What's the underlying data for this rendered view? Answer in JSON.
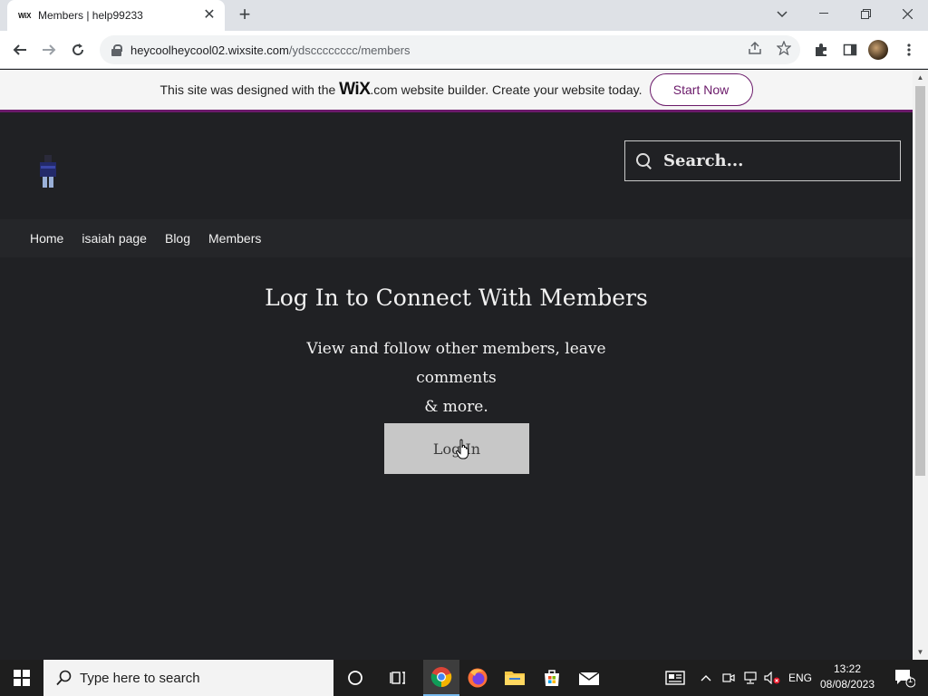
{
  "browser": {
    "tab_favicon": "WiX",
    "tab_title": "Members | help99233",
    "tab_close": "✕",
    "new_tab": "+",
    "url_host": "heycoolheycool02.wixsite.com",
    "url_path": "/ydscccccccc/members"
  },
  "wix_banner": {
    "text_before": "This site was designed with the",
    "logo": "WiX",
    "text_after": ".com website builder. Create your website today.",
    "cta": "Start Now"
  },
  "site": {
    "search_placeholder": "Search...",
    "nav": [
      "Home",
      "isaiah page",
      "Blog",
      "Members"
    ],
    "title": "Log In to Connect With Members",
    "subtitle_line1": "View and follow other members, leave comments",
    "subtitle_line2": "& more.",
    "login_label": "Log In"
  },
  "taskbar": {
    "search_placeholder": "Type here to search",
    "language": "ENG",
    "time": "13:22",
    "date": "08/08/2023",
    "notification_count": "1"
  },
  "colors": {
    "accent": "#6b1a6a",
    "page_bg": "#202124",
    "button_bg": "#c7c7c7"
  }
}
